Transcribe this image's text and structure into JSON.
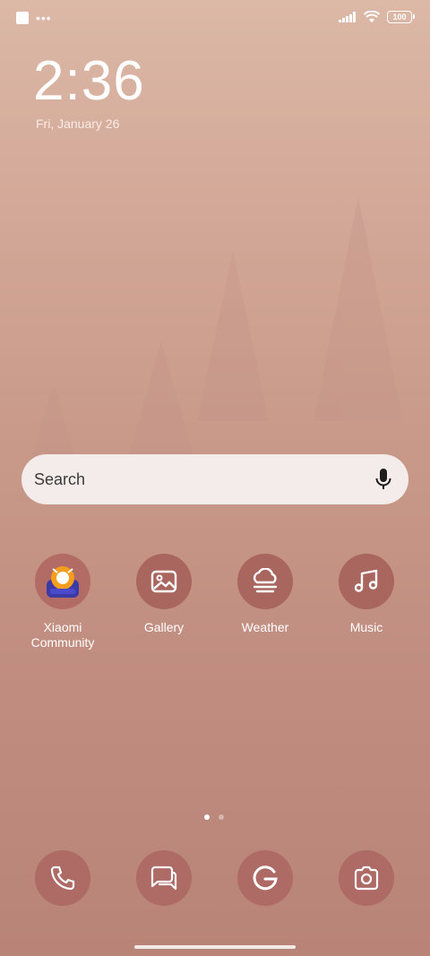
{
  "status_bar": {
    "battery": "100",
    "dots": "•••"
  },
  "lock": {
    "time": "2:36",
    "date": "Fri, January 26"
  },
  "search": {
    "placeholder": "Search"
  },
  "apps": [
    {
      "label": "Xiaomi Community",
      "icon": "xiaomi-community-icon"
    },
    {
      "label": "Gallery",
      "icon": "gallery-icon"
    },
    {
      "label": "Weather",
      "icon": "weather-icon"
    },
    {
      "label": "Music",
      "icon": "music-icon"
    }
  ],
  "dock": [
    {
      "icon": "phone-icon"
    },
    {
      "icon": "messages-icon"
    },
    {
      "icon": "google-icon"
    },
    {
      "icon": "camera-icon"
    }
  ],
  "pager": {
    "active_color": "#ffffff",
    "inactive_color": "#d9b6ad"
  },
  "colors": {
    "background_top": "#dcb8a6",
    "background_bottom": "#b98478",
    "icon_bg": "#a8665f"
  }
}
